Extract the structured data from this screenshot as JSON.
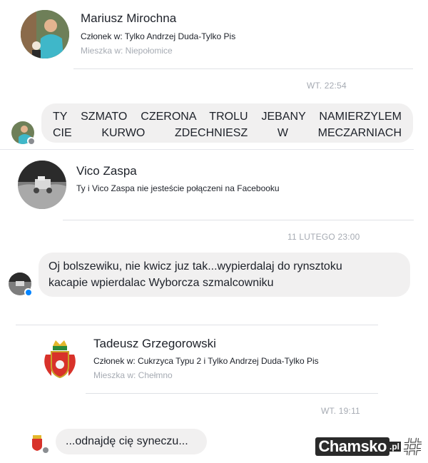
{
  "threads": [
    {
      "profile": {
        "name": "Mariusz Mirochna",
        "membership": "Członek w: Tylko Andrzej Duda-Tylko Pis",
        "location": "Mieszka w: Niepołomice"
      },
      "timestamp": "WT. 22:54",
      "messages": [
        "TY SZMATO CZERONA TROLU JEBANY NAMIERZYLEM",
        "CIE KURWO ZDECHNIESZ W MECZARNIACH"
      ]
    },
    {
      "profile": {
        "name": "Vico Zaspa",
        "connection": "Ty i Vico Zaspa nie jesteście połączeni na Facebooku"
      },
      "timestamp": "11 LUTEGO 23:00",
      "messages": [
        "Oj bolszewiku, nie kwicz juz tak...wypierdalaj do rynsztoku",
        "kacapie wpierdalac Wyborcza szmalcowniku"
      ]
    },
    {
      "profile": {
        "name": "Tadeusz Grzegorowski",
        "membership": "Członek w: Cukrzyca Typu 2 i Tylko Andrzej Duda-Tylko Pis",
        "location": "Mieszka w: Chełmno"
      },
      "timestamp": "WT. 19:11",
      "messages": [
        "...odnajdę cię syneczu..."
      ]
    }
  ],
  "watermark": {
    "text": "Chamsko",
    "suffix": ".pl"
  },
  "colors": {
    "bubble": "#f1f0f0",
    "meta_grey": "#a6abb3",
    "messenger_blue": "#0084ff"
  }
}
